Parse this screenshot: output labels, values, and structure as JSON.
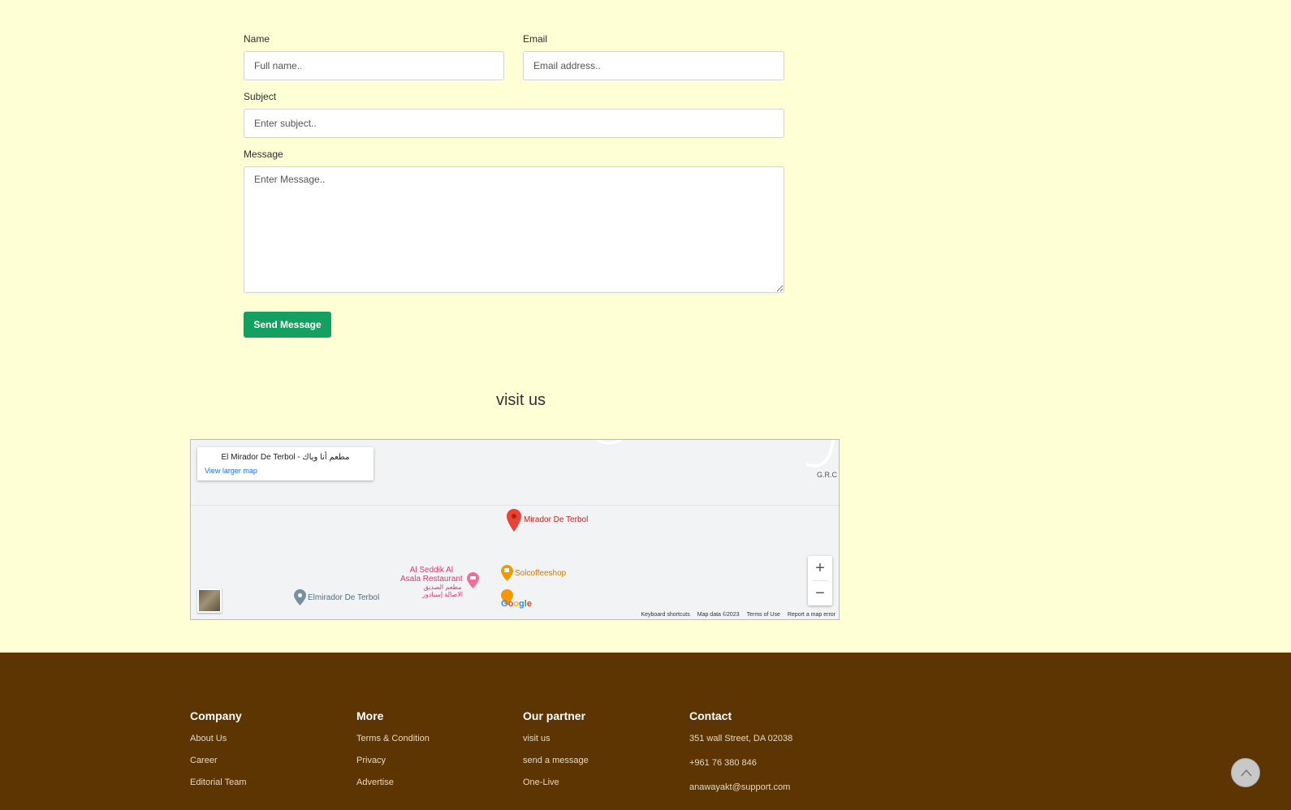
{
  "form": {
    "name_label": "Name",
    "name_placeholder": "Full name..",
    "email_label": "Email",
    "email_placeholder": "Email address..",
    "subject_label": "Subject",
    "subject_placeholder": "Enter subject..",
    "message_label": "Message",
    "message_placeholder": "Enter Message..",
    "send_label": "Send Message"
  },
  "visit": {
    "title": "visit us"
  },
  "map": {
    "card_title": "El Mirador De Terbol - مطعم أنا وياك",
    "larger_map": "View larger map",
    "pin_label": "Mirador De Terbol",
    "poi_restaurant": "Al Seddik Al\nAsala Restaurant",
    "poi_restaurant_ar": "مطعم الصديق\nالاصالة إسيادور",
    "poi_coffee": "Solcoffeeshop",
    "poi_elmirador": "Elmirador De Terbol",
    "grc": "G.R.C",
    "google": "Google",
    "zoom_in": "+",
    "zoom_out": "−",
    "attrib": [
      "Keyboard shortcuts",
      "Map data ©2023",
      "Terms of Use",
      "Report a map error"
    ]
  },
  "footer": {
    "company": {
      "title": "Company",
      "links": [
        "About Us",
        "Career",
        "Editorial Team"
      ]
    },
    "more": {
      "title": "More",
      "links": [
        "Terms & Condition",
        "Privacy",
        "Advertise"
      ]
    },
    "partner": {
      "title": "Our partner",
      "links": [
        "visit us",
        "send a message",
        "One-Live"
      ]
    },
    "contact": {
      "title": "Contact",
      "items": [
        "351 wall Street, DA 02038",
        "+961 76 380 846",
        "anawayakt@support.com"
      ]
    }
  },
  "colors": {
    "page_bg": "#ffffd6",
    "button": "#14a060",
    "footer_bg": "#5c3502"
  }
}
